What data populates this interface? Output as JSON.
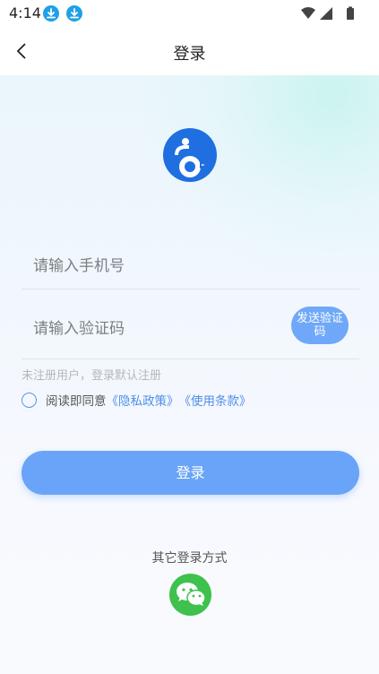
{
  "status_bar": {
    "time": "4:14",
    "icons": [
      "download-icon",
      "download-icon",
      "wifi-icon",
      "signal-icon",
      "battery-icon"
    ]
  },
  "nav": {
    "title": "登录",
    "back_icon": "chevron-left-icon"
  },
  "logo": {
    "icon": "app-logo-icon",
    "color": "#1f6fe0"
  },
  "form": {
    "phone_placeholder": "请输入手机号",
    "code_placeholder": "请输入验证码",
    "send_code_label": "发送验证码",
    "hint": "未注册用户，登录默认注册",
    "agree_prefix": "阅读即同意",
    "privacy_link": "《隐私政策》",
    "terms_link": "《使用条款》",
    "login_label": "登录"
  },
  "other_login": {
    "label": "其它登录方式",
    "wechat_icon": "wechat-icon",
    "wechat_color": "#3ec14d"
  },
  "colors": {
    "accent": "#6aa4f8",
    "link": "#4d8ee8"
  }
}
